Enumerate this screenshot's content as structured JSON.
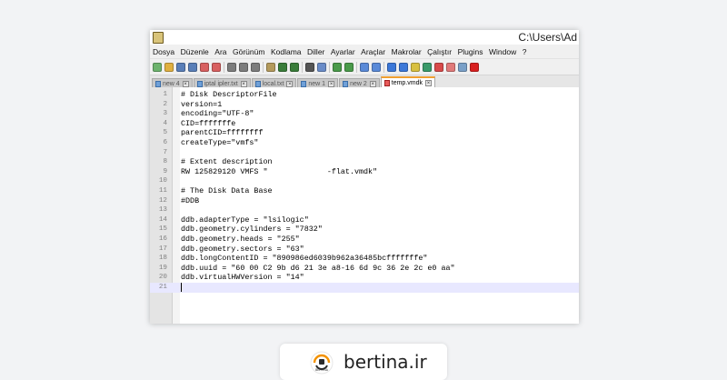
{
  "window": {
    "title": "C:\\Users\\Ad"
  },
  "menu": [
    "Dosya",
    "Düzenle",
    "Ara",
    "Görünüm",
    "Kodlama",
    "Diller",
    "Ayarlar",
    "Araçlar",
    "Makrolar",
    "Çalıştır",
    "Plugins",
    "Window",
    "?"
  ],
  "toolbar_icons": [
    "new-file-icon",
    "open-folder-icon",
    "save-icon",
    "save-all-icon",
    "close-icon",
    "close-all-icon",
    "print-icon",
    "cut-icon",
    "copy-icon",
    "paste-icon",
    "undo-icon",
    "redo-icon",
    "find-icon",
    "replace-icon",
    "zoom-in-icon",
    "zoom-out-icon",
    "sync-vertical-icon",
    "sync-horizontal-icon",
    "word-wrap-icon",
    "show-all-chars-icon",
    "indent-guide-icon",
    "doc-map-icon",
    "function-list-icon",
    "folder-workspace-icon",
    "monitor-icon",
    "macro-record-icon"
  ],
  "tabs": [
    {
      "label": "new 4",
      "modified": false,
      "active": false
    },
    {
      "label": "iptal ipler.txt",
      "modified": false,
      "active": false
    },
    {
      "label": "local.txt",
      "modified": false,
      "active": false
    },
    {
      "label": "new 1",
      "modified": false,
      "active": false
    },
    {
      "label": "new 2",
      "modified": false,
      "active": false
    },
    {
      "label": "temp.vmdk",
      "modified": true,
      "active": true
    }
  ],
  "editor": {
    "lines": [
      "# Disk DescriptorFile",
      "version=1",
      "encoding=\"UTF-8\"",
      "CID=fffffffe",
      "parentCID=ffffffff",
      "createType=\"vmfs\"",
      "",
      "# Extent description",
      "RW 125829120 VMFS \"             -flat.vmdk\"",
      "",
      "# The Disk Data Base",
      "#DDB",
      "",
      "ddb.adapterType = \"lsilogic\"",
      "ddb.geometry.cylinders = \"7832\"",
      "ddb.geometry.heads = \"255\"",
      "ddb.geometry.sectors = \"63\"",
      "ddb.longContentID = \"890986ed6039b962a36485bcfffffffe\"",
      "ddb.uuid = \"60 00 C2 9b d6 21 3e a8-16 6d 9c 36 2e 2c e0 aa\"",
      "ddb.virtualHWVersion = \"14\"",
      ""
    ],
    "current_line": 21
  },
  "footer": {
    "brand": "bertina.ir",
    "logo_text": "BERTINA"
  },
  "colors": {
    "accent_tab": "#f0a030",
    "current_line": "#e8e8ff",
    "logo_orange": "#f39200",
    "logo_dark": "#2b2b2b"
  }
}
